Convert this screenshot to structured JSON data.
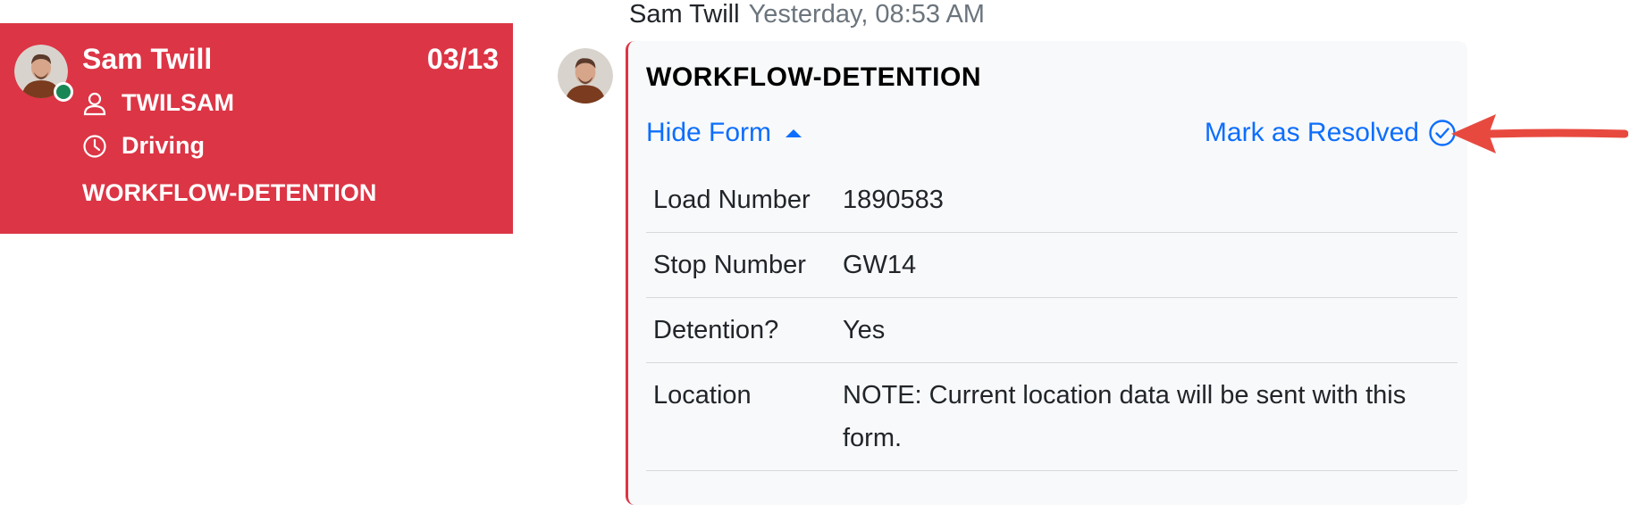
{
  "conversation": {
    "name": "Sam Twill",
    "count": "03/13",
    "user_id": "TWILSAM",
    "status": "Driving",
    "workflow": "WORKFLOW-DETENTION",
    "user_icon": "person-icon",
    "status_icon": "clock-icon"
  },
  "message": {
    "sender": "Sam Twill",
    "time": "Yesterday, 08:53 AM",
    "title": "WORKFLOW-DETENTION",
    "hide_form_label": "Hide Form",
    "resolve_label": "Mark as Resolved",
    "fields": [
      {
        "label": "Load Number",
        "value": "1890583"
      },
      {
        "label": "Stop Number",
        "value": "GW14"
      },
      {
        "label": "Detention?",
        "value": "Yes"
      },
      {
        "label": "Location",
        "value": "NOTE: Current location data will be sent with this form."
      }
    ]
  },
  "colors": {
    "card_red": "#dc3545",
    "link_blue": "#0d6efd",
    "presence_green": "#198754",
    "arrow_red": "#e8493f"
  }
}
